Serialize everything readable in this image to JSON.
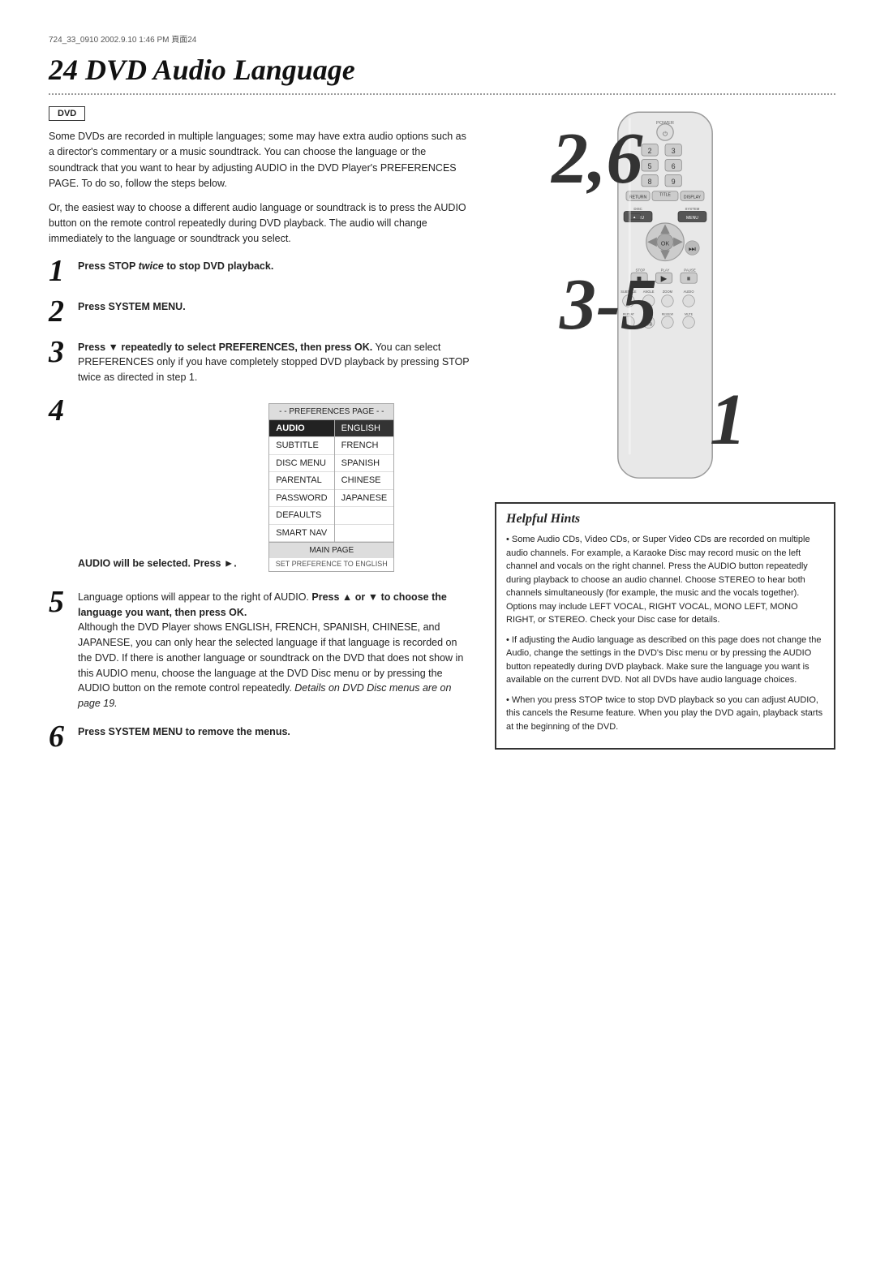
{
  "header": {
    "meta": "724_33_0910  2002.9.10  1:46 PM  頁面24",
    "title": "24  DVD Audio Language"
  },
  "dvd_badge": "DVD",
  "intro": {
    "para1": "Some DVDs are recorded in multiple languages; some may have extra audio options such as a director's commentary or a music soundtrack. You can choose the language or the soundtrack that you want to hear by adjusting AUDIO in the DVD Player's PREFERENCES PAGE. To do so, follow the steps below.",
    "para2": "Or, the easiest way to choose a different audio language or soundtrack is to press the AUDIO button on the remote control repeatedly during DVD playback. The audio will change immediately to the language or soundtrack you select."
  },
  "steps": [
    {
      "number": "1",
      "text": "Press STOP twice to stop DVD playback."
    },
    {
      "number": "2",
      "text": "Press SYSTEM MENU."
    },
    {
      "number": "3",
      "text_bold": "Press ▼ repeatedly to select PREFERENCES, then press OK.",
      "text_normal": " You can select PREFERENCES only if you have completely stopped DVD playback by pressing STOP twice as directed in step 1."
    },
    {
      "number": "4",
      "text_bold": "AUDIO will be selected. Press ►."
    },
    {
      "number": "5",
      "text_bold": "to choose the language you want, then press OK.",
      "text_intro": "Language options will appear to the right of AUDIO. Press ▲ or ▼",
      "text_normal": "Although the DVD Player shows ENGLISH, FRENCH, SPANISH, CHINESE, and JAPANESE, you can only hear the selected language if that language is recorded on the DVD. If there is another language or soundtrack on the DVD that does not show in this AUDIO menu, choose the language at the DVD Disc menu or by pressing the AUDIO button on the remote control repeatedly.",
      "text_italic": "Details on DVD Disc menus are on page 19."
    },
    {
      "number": "6",
      "text_bold": "Press SYSTEM MENU to remove the menus."
    }
  ],
  "pref_table": {
    "header": "- - PREFERENCES PAGE - -",
    "col1": [
      "AUDIO",
      "SUBTITLE",
      "DISC MENU",
      "PARENTAL",
      "PASSWORD",
      "DEFAULTS",
      "SMART NAV"
    ],
    "col2": [
      "ENGLISH",
      "FRENCH",
      "SPANISH",
      "CHINESE",
      "JAPANESE"
    ],
    "footer": "MAIN PAGE",
    "footer_sub": "SET PREFERENCE TO ENGLISH"
  },
  "large_numbers": {
    "top": "2,6",
    "middle": "3-5",
    "bottom": "1"
  },
  "helpful_hints": {
    "title": "Helpful Hints",
    "hints": [
      "Some Audio CDs, Video CDs, or Super Video CDs are recorded on multiple audio channels. For example, a Karaoke Disc may record music on the left channel and vocals on the right channel. Press the AUDIO button repeatedly during playback to choose an audio channel. Choose STEREO to hear both channels simultaneously (for example, the music and the vocals together). Options may include LEFT VOCAL, RIGHT VOCAL, MONO LEFT, MONO RIGHT, or STEREO. Check your Disc case for details.",
      "If adjusting the Audio language as described on this page does not change the Audio, change the settings in the DVD's Disc menu or by pressing the AUDIO button repeatedly during DVD playback. Make sure the language you want is available on the current DVD. Not all DVDs have audio language choices.",
      "When you press STOP twice to stop DVD playback so you can adjust AUDIO, this cancels the Resume feature. When you play the DVD again, playback starts at the beginning of the DVD."
    ]
  }
}
